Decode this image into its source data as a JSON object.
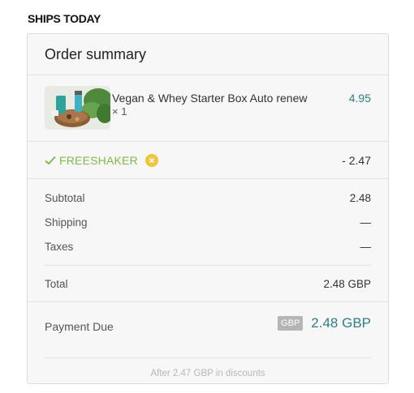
{
  "ships_label": "SHIPS TODAY",
  "summary": {
    "title": "Order summary",
    "item": {
      "name": "Vegan & Whey Starter Box Auto renew",
      "quantity": "× 1",
      "price": "4.95",
      "image_alt": "product-image"
    },
    "discount": {
      "code": "FREESHAKER",
      "amount": "- 2.47",
      "check_color": "#7fba4a",
      "remove_color": "#f0c53a"
    },
    "totals": {
      "subtotal_label": "Subtotal",
      "subtotal_value": "2.48",
      "shipping_label": "Shipping",
      "shipping_value": "—",
      "taxes_label": "Taxes",
      "taxes_value": "—",
      "total_label": "Total",
      "total_value": "2.48 GBP"
    },
    "payment": {
      "label": "Payment Due",
      "currency": "GBP",
      "amount": "2.48 GBP",
      "discount_note": "After 2.47 GBP in discounts",
      "accent_color": "#2f7f86"
    }
  }
}
